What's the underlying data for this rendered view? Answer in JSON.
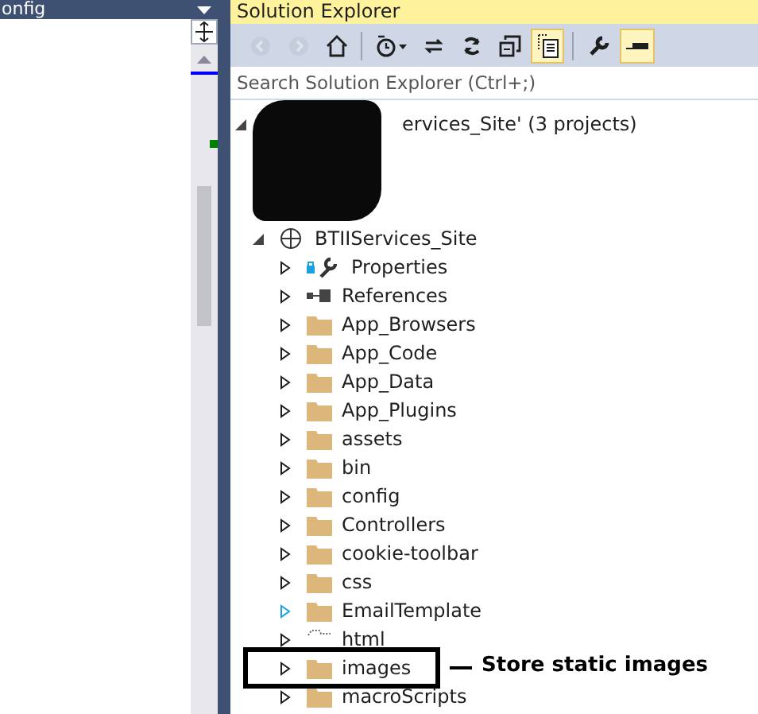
{
  "editor": {
    "tab_title": "onfig"
  },
  "solution_explorer": {
    "title": "Solution Explorer",
    "toolbar": [
      {
        "kind": "back",
        "disabled": true,
        "selected": false
      },
      {
        "kind": "forward",
        "disabled": true,
        "selected": false
      },
      {
        "kind": "home",
        "disabled": false,
        "selected": false
      },
      {
        "kind": "separator"
      },
      {
        "kind": "history",
        "disabled": false,
        "selected": false
      },
      {
        "kind": "sync",
        "disabled": false,
        "selected": false
      },
      {
        "kind": "refresh",
        "disabled": false,
        "selected": false
      },
      {
        "kind": "collapse",
        "disabled": false,
        "selected": false
      },
      {
        "kind": "show-all",
        "disabled": false,
        "selected": true
      },
      {
        "kind": "separator"
      },
      {
        "kind": "properties",
        "disabled": false,
        "selected": false
      },
      {
        "kind": "preview",
        "disabled": false,
        "selected": true
      }
    ],
    "search": {
      "placeholder": "Search Solution Explorer (Ctrl+;)"
    },
    "tree": {
      "label": "ervices_Site' (3 projects)",
      "expanded": true,
      "children": [
        {
          "label": "BTIIServices_Site",
          "kind": "project",
          "expanded": true,
          "children": [
            {
              "label": "Properties",
              "kind": "properties",
              "expanded": false
            },
            {
              "label": "References",
              "kind": "references",
              "expanded": false
            },
            {
              "label": "App_Browsers",
              "kind": "folder",
              "expanded": false
            },
            {
              "label": "App_Code",
              "kind": "folder",
              "expanded": false
            },
            {
              "label": "App_Data",
              "kind": "folder",
              "expanded": false
            },
            {
              "label": "App_Plugins",
              "kind": "folder",
              "expanded": false
            },
            {
              "label": "assets",
              "kind": "folder",
              "expanded": false
            },
            {
              "label": "bin",
              "kind": "folder",
              "expanded": false
            },
            {
              "label": "config",
              "kind": "folder",
              "expanded": false
            },
            {
              "label": "Controllers",
              "kind": "folder",
              "expanded": false
            },
            {
              "label": "cookie-toolbar",
              "kind": "folder",
              "expanded": false
            },
            {
              "label": "css",
              "kind": "folder",
              "expanded": false
            },
            {
              "label": "EmailTemplate",
              "kind": "folder",
              "expanded": false,
              "hover": true
            },
            {
              "label": "html",
              "kind": "excluded",
              "expanded": false
            },
            {
              "label": "images",
              "kind": "folder",
              "expanded": false,
              "callout": "Store static images"
            },
            {
              "label": "macroScripts",
              "kind": "folder",
              "expanded": false
            }
          ]
        }
      ]
    }
  }
}
